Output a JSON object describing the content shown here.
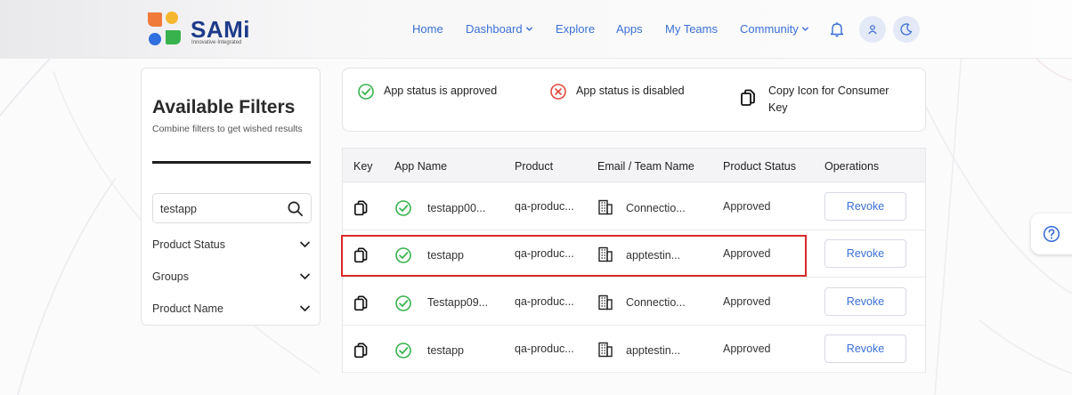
{
  "brand": {
    "name": "SAMi",
    "tagline": "Innovative·Integrated",
    "colors": {
      "orange": "#f07a3a",
      "yellow": "#f5b731",
      "blue": "#2f6fe0",
      "green": "#37b24d",
      "navy": "#1e3a8a"
    }
  },
  "nav": {
    "items": [
      {
        "label": "Home",
        "has_dropdown": false
      },
      {
        "label": "Dashboard",
        "has_dropdown": true
      },
      {
        "label": "Explore",
        "has_dropdown": false
      },
      {
        "label": "Apps",
        "has_dropdown": false
      },
      {
        "label": "My Teams",
        "has_dropdown": false
      },
      {
        "label": "Community",
        "has_dropdown": true
      }
    ],
    "icons": [
      "bell-icon",
      "user-icon",
      "moon-icon"
    ],
    "link_color": "#3b6fd8"
  },
  "filters": {
    "title": "Available Filters",
    "subtitle": "Combine filters to get wished results",
    "search_value": "testapp",
    "groups": [
      {
        "label": "Product Status"
      },
      {
        "label": "Groups"
      },
      {
        "label": "Product Name"
      }
    ]
  },
  "legend": {
    "approved": "App status is approved",
    "disabled": "App status is disabled",
    "copy": "Copy Icon for Consumer Key"
  },
  "table": {
    "headers": {
      "key": "Key",
      "app_name": "App Name",
      "product": "Product",
      "email_team": "Email / Team Name",
      "product_status": "Product Status",
      "operations": "Operations"
    },
    "rows": [
      {
        "app_name": "testapp00...",
        "product": "qa-produc...",
        "team": "Connectio...",
        "status": "Approved",
        "action": "Revoke"
      },
      {
        "app_name": "testapp",
        "product": "qa-produc...",
        "team": "apptestin...",
        "status": "Approved",
        "action": "Revoke"
      },
      {
        "app_name": "Testapp09...",
        "product": "qa-produc...",
        "team": "Connectio...",
        "status": "Approved",
        "action": "Revoke"
      },
      {
        "app_name": "testapp",
        "product": "qa-produc...",
        "team": "apptestin...",
        "status": "Approved",
        "action": "Revoke"
      }
    ],
    "highlighted_row": 2,
    "highlight_color": "#d92a2a"
  },
  "status_colors": {
    "approved": "#37b24d",
    "disabled": "#e04a3b"
  }
}
